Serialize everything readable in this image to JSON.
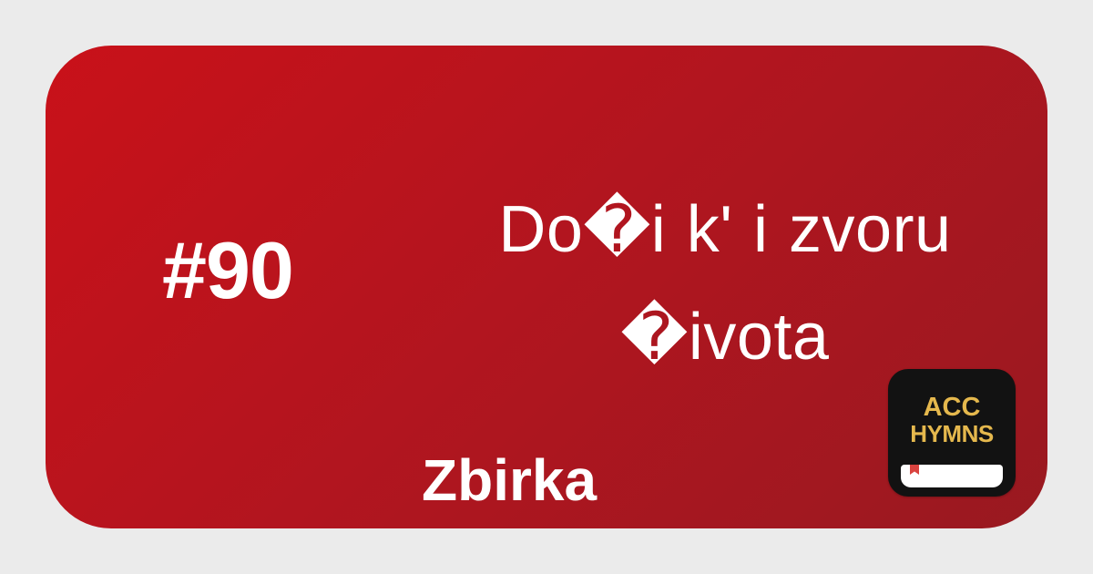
{
  "hymn": {
    "number": "#90",
    "title_lines": [
      "Do�i k' i zvoru",
      "�ivota"
    ],
    "collection": "Zbirka"
  },
  "app": {
    "line1": "ACC",
    "line2": "HYMNS",
    "icons": {
      "bookmark": "bookmark-icon",
      "book": "book-icon"
    }
  },
  "colors": {
    "background": "#ebebeb",
    "card_start": "#c91119",
    "card_end": "#991920",
    "text": "#ffffff",
    "badge_background": "#121212",
    "badge_text": "#e5b84d",
    "bookmark": "#d9433f"
  }
}
